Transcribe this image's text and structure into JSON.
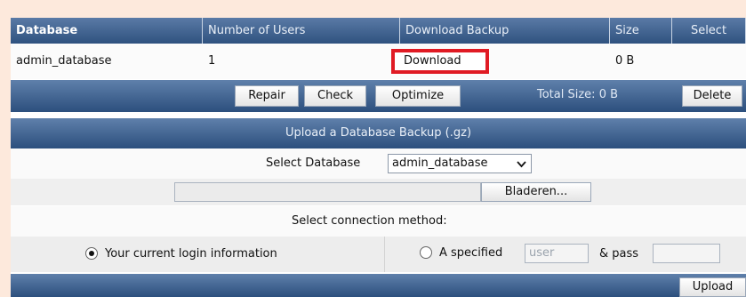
{
  "table": {
    "headers": [
      "Database",
      "Number of Users",
      "Download Backup",
      "Size",
      "Select"
    ],
    "row": {
      "database": "admin_database",
      "users": "1",
      "download": "Download",
      "size": "0 B"
    }
  },
  "actions": {
    "repair": "Repair",
    "check": "Check",
    "optimize": "Optimize",
    "total_size": "Total Size: 0 B",
    "delete": "Delete"
  },
  "upload": {
    "title": "Upload a Database Backup (.gz)",
    "select_label": "Select Database",
    "select_value": "admin_database",
    "browse": "Bladeren...",
    "method_label": "Select connection method:",
    "option_current": "Your current login information",
    "option_specified": "A specified",
    "user_placeholder": "user",
    "pass_label": "& pass",
    "upload_button": "Upload"
  },
  "colors": {
    "header_top": "#5a7aa6",
    "header_bottom": "#2f527f",
    "highlight": "#e01b24",
    "accent_bg": "#fde9dc"
  },
  "icons": {
    "select_caret": "chevron-down-icon",
    "radio_selected": "radio-checked-icon",
    "radio_unselected": "radio-unchecked-icon"
  }
}
